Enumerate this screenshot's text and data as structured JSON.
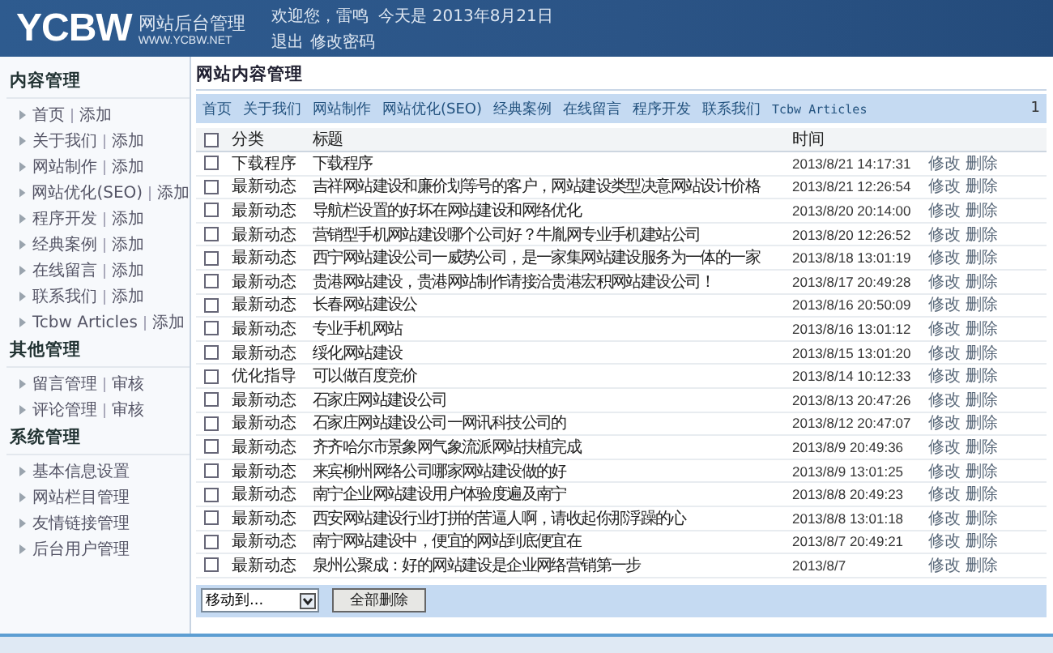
{
  "header": {
    "logo": "YCBW",
    "system_name": "网站后台管理",
    "site_url": "WWW.YCBW.NET",
    "welcome": "欢迎您，雷鸣  今天是 2013年8月21日",
    "links": [
      "退出",
      "修改密码"
    ]
  },
  "sidebar": {
    "sections": [
      {
        "title": "内容管理",
        "items": [
          {
            "label": "首页",
            "action": "添加"
          },
          {
            "label": "关于我们",
            "action": "添加"
          },
          {
            "label": "网站制作",
            "action": "添加"
          },
          {
            "label": "网站优化(SEO)",
            "action": "添加"
          },
          {
            "label": "程序开发",
            "action": "添加"
          },
          {
            "label": "经典案例",
            "action": "添加"
          },
          {
            "label": "在线留言",
            "action": "添加"
          },
          {
            "label": "联系我们",
            "action": "添加"
          },
          {
            "label": "Tcbw Articles",
            "action": "添加"
          }
        ]
      },
      {
        "title": "其他管理",
        "items": [
          {
            "label": "留言管理",
            "action": "审核"
          },
          {
            "label": "评论管理",
            "action": "审核"
          }
        ]
      },
      {
        "title": "系统管理",
        "items": [
          {
            "label": "基本信息设置"
          },
          {
            "label": "网站栏目管理"
          },
          {
            "label": "友情链接管理"
          },
          {
            "label": "后台用户管理"
          }
        ]
      }
    ]
  },
  "main": {
    "title": "网站内容管理",
    "nav": {
      "items": [
        "首页",
        "关于我们",
        "网站制作",
        "网站优化(SEO)",
        "经典案例",
        "在线留言",
        "程序开发",
        "联系我们",
        "Tcbw Articles"
      ],
      "page": "1"
    },
    "table": {
      "select_all_checked": false,
      "columns": [
        "分类",
        "标题",
        "时间"
      ],
      "rows": [
        {
          "checked": false,
          "category": "下载程序",
          "title": "下载程序",
          "time": "2013/8/21 14:17:31",
          "actions": [
            "修改",
            "删除"
          ]
        },
        {
          "checked": false,
          "category": "最新动态",
          "title": "吉祥网站建设和廉价划等号的客户，网站建设类型决意网站设计价格",
          "time": "2013/8/21 12:26:54",
          "actions": [
            "修改",
            "删除"
          ]
        },
        {
          "checked": false,
          "category": "最新动态",
          "title": "导航栏设置的好坏在网站建设和网络优化",
          "time": "2013/8/20 20:14:00",
          "actions": [
            "修改",
            "删除"
          ]
        },
        {
          "checked": false,
          "category": "最新动态",
          "title": "营销型手机网站建设哪个公司好？牛胤网专业手机建站公司",
          "time": "2013/8/20 12:26:52",
          "actions": [
            "修改",
            "删除"
          ]
        },
        {
          "checked": false,
          "category": "最新动态",
          "title": "西宁网站建设公司一威势公司，是一家集网站建设服务为一体的一家",
          "time": "2013/8/18 13:01:19",
          "actions": [
            "修改",
            "删除"
          ]
        },
        {
          "checked": false,
          "category": "最新动态",
          "title": "贵港网站建设，贵港网站制作请接洽贵港宏积网站建设公司！",
          "time": "2013/8/17 20:49:28",
          "actions": [
            "修改",
            "删除"
          ]
        },
        {
          "checked": false,
          "category": "最新动态",
          "title": "长春网站建设公",
          "time": "2013/8/16 20:50:09",
          "actions": [
            "修改",
            "删除"
          ]
        },
        {
          "checked": false,
          "category": "最新动态",
          "title": "专业手机网站",
          "time": "2013/8/16 13:01:12",
          "actions": [
            "修改",
            "删除"
          ]
        },
        {
          "checked": false,
          "category": "最新动态",
          "title": "绥化网站建设",
          "time": "2013/8/15 13:01:20",
          "actions": [
            "修改",
            "删除"
          ]
        },
        {
          "checked": false,
          "category": "优化指导",
          "title": "可以做百度竞价",
          "time": "2013/8/14 10:12:33",
          "actions": [
            "修改",
            "删除"
          ]
        },
        {
          "checked": false,
          "category": "最新动态",
          "title": "石家庄网站建设公司",
          "time": "2013/8/13 20:47:26",
          "actions": [
            "修改",
            "删除"
          ]
        },
        {
          "checked": false,
          "category": "最新动态",
          "title": "石家庄网站建设公司一网讯科技公司的",
          "time": "2013/8/12 20:47:07",
          "actions": [
            "修改",
            "删除"
          ]
        },
        {
          "checked": false,
          "category": "最新动态",
          "title": "齐齐哈尔市景象网气象流派网站扶植完成",
          "time": "2013/8/9 20:49:36",
          "actions": [
            "修改",
            "删除"
          ]
        },
        {
          "checked": false,
          "category": "最新动态",
          "title": "来宾柳州网络公司哪家网站建设做的好",
          "time": "2013/8/9 13:01:25",
          "actions": [
            "修改",
            "删除"
          ]
        },
        {
          "checked": false,
          "category": "最新动态",
          "title": "南宁企业网站建设用户体验度遍及南宁",
          "time": "2013/8/8 20:49:23",
          "actions": [
            "修改",
            "删除"
          ]
        },
        {
          "checked": false,
          "category": "最新动态",
          "title": "西安网站建设行业打拼的苦逼人啊，请收起你那浮躁的心",
          "time": "2013/8/8 13:01:18",
          "actions": [
            "修改",
            "删除"
          ]
        },
        {
          "checked": false,
          "category": "最新动态",
          "title": "南宁网站建设中，便宜的网站到底便宜在",
          "time": "2013/8/7 20:49:21",
          "actions": [
            "修改",
            "删除"
          ]
        },
        {
          "checked": false,
          "category": "最新动态",
          "title": "泉州公聚成：好的网站建设是企业网络营销第一步",
          "time": "2013/8/7",
          "actions": [
            "修改",
            "删除"
          ]
        }
      ]
    },
    "footer": {
      "move_select": "移动到...",
      "delete_all": "全部删除"
    }
  }
}
